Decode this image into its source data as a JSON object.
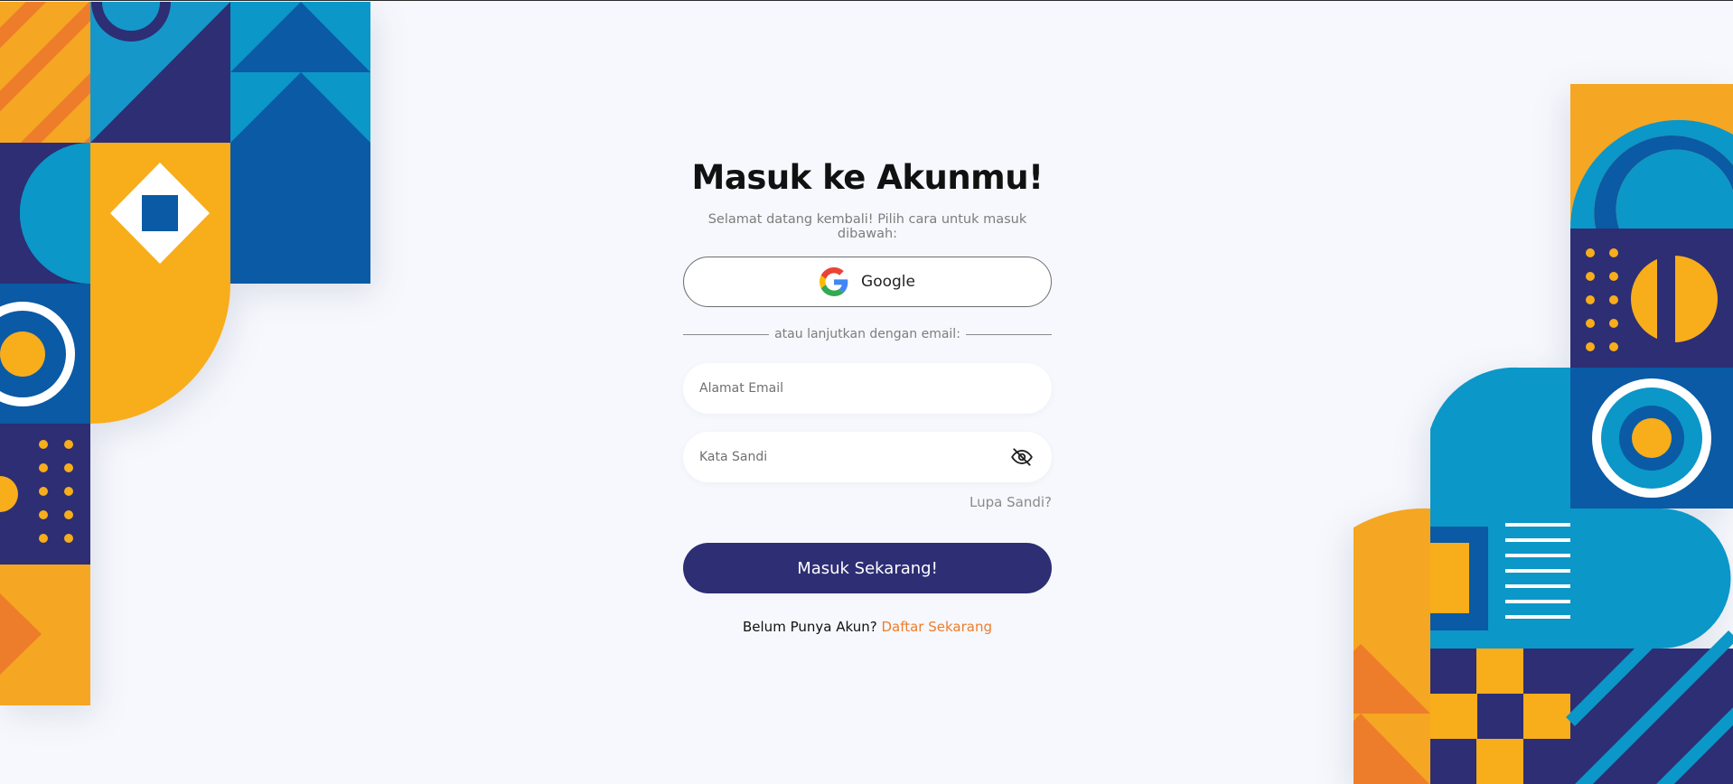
{
  "login": {
    "title": "Masuk ke Akunmu!",
    "subtitle": "Selamat datang kembali! Pilih cara untuk masuk dibawah:",
    "google_label": "Google",
    "divider_text": "atau lanjutkan dengan email:",
    "email_placeholder": "Alamat Email",
    "password_placeholder": "Kata Sandi",
    "forgot_label": "Lupa Sandi?",
    "submit_label": "Masuk Sekarang!",
    "register_prompt": "Belum Punya Akun?",
    "register_link": "Daftar Sekarang"
  },
  "icons": {
    "google": "google-logo-icon",
    "toggle_password": "eye-slash-icon"
  },
  "colors": {
    "background": "#f6f8fd",
    "primary": "#2d2e74",
    "accent": "#ee7d2b",
    "deco_navy": "#2d2e74",
    "deco_blue": "#0a5aa5",
    "deco_cyan": "#0b97c8",
    "deco_yellow": "#f8ad1b",
    "deco_orange": "#ee7d2b"
  }
}
